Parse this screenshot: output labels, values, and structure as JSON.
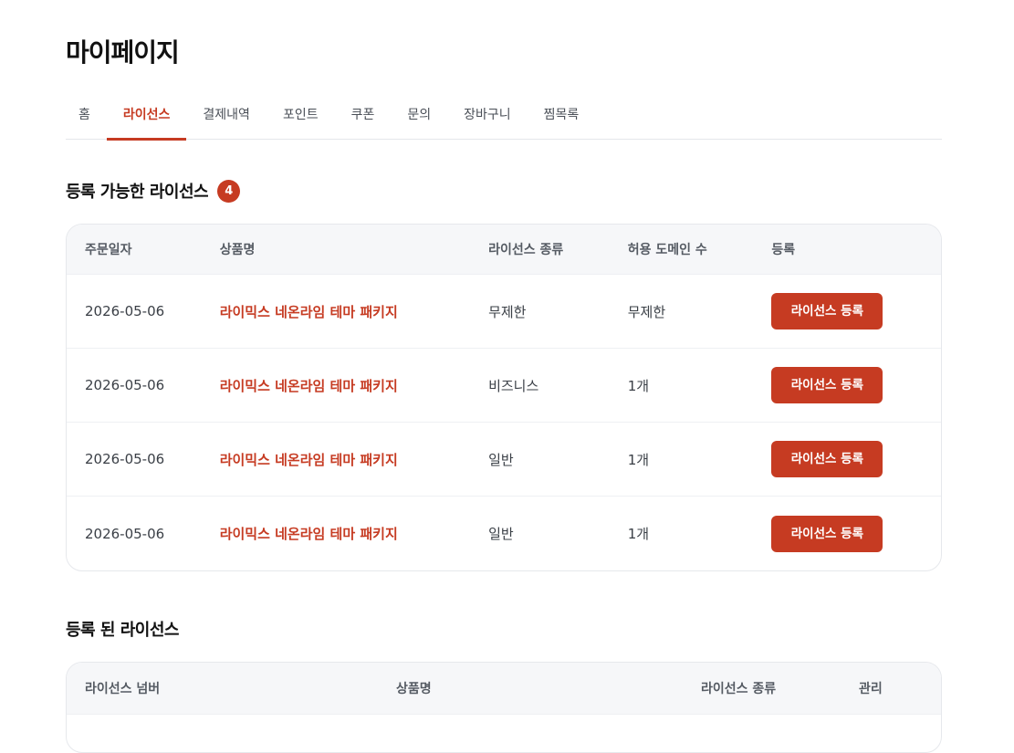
{
  "page_title": "마이페이지",
  "tabs": [
    {
      "label": "홈",
      "active": false
    },
    {
      "label": "라이선스",
      "active": true
    },
    {
      "label": "결제내역",
      "active": false
    },
    {
      "label": "포인트",
      "active": false
    },
    {
      "label": "쿠폰",
      "active": false
    },
    {
      "label": "문의",
      "active": false
    },
    {
      "label": "장바구니",
      "active": false
    },
    {
      "label": "찜목록",
      "active": false
    }
  ],
  "available": {
    "title": "등록 가능한 라이선스",
    "count": "4",
    "headers": {
      "order_date": "주문일자",
      "product": "상품명",
      "license_type": "라이선스 종류",
      "domains": "허용 도메인 수",
      "register": "등록"
    },
    "rows": [
      {
        "order_date": "2026-05-06",
        "product": "라이믹스 네온라임 테마 패키지",
        "license_type": "무제한",
        "domains": "무제한",
        "button": "라이선스 등록"
      },
      {
        "order_date": "2026-05-06",
        "product": "라이믹스 네온라임 테마 패키지",
        "license_type": "비즈니스",
        "domains": "1개",
        "button": "라이선스 등록"
      },
      {
        "order_date": "2026-05-06",
        "product": "라이믹스 네온라임 테마 패키지",
        "license_type": "일반",
        "domains": "1개",
        "button": "라이선스 등록"
      },
      {
        "order_date": "2026-05-06",
        "product": "라이믹스 네온라임 테마 패키지",
        "license_type": "일반",
        "domains": "1개",
        "button": "라이선스 등록"
      }
    ]
  },
  "registered": {
    "title": "등록 된 라이선스",
    "headers": {
      "license_number": "라이선스 넘버",
      "product": "상품명",
      "license_type": "라이선스 종류",
      "manage": "관리"
    }
  },
  "colors": {
    "accent": "#c63b22",
    "header_bg": "#f6f7f9"
  }
}
